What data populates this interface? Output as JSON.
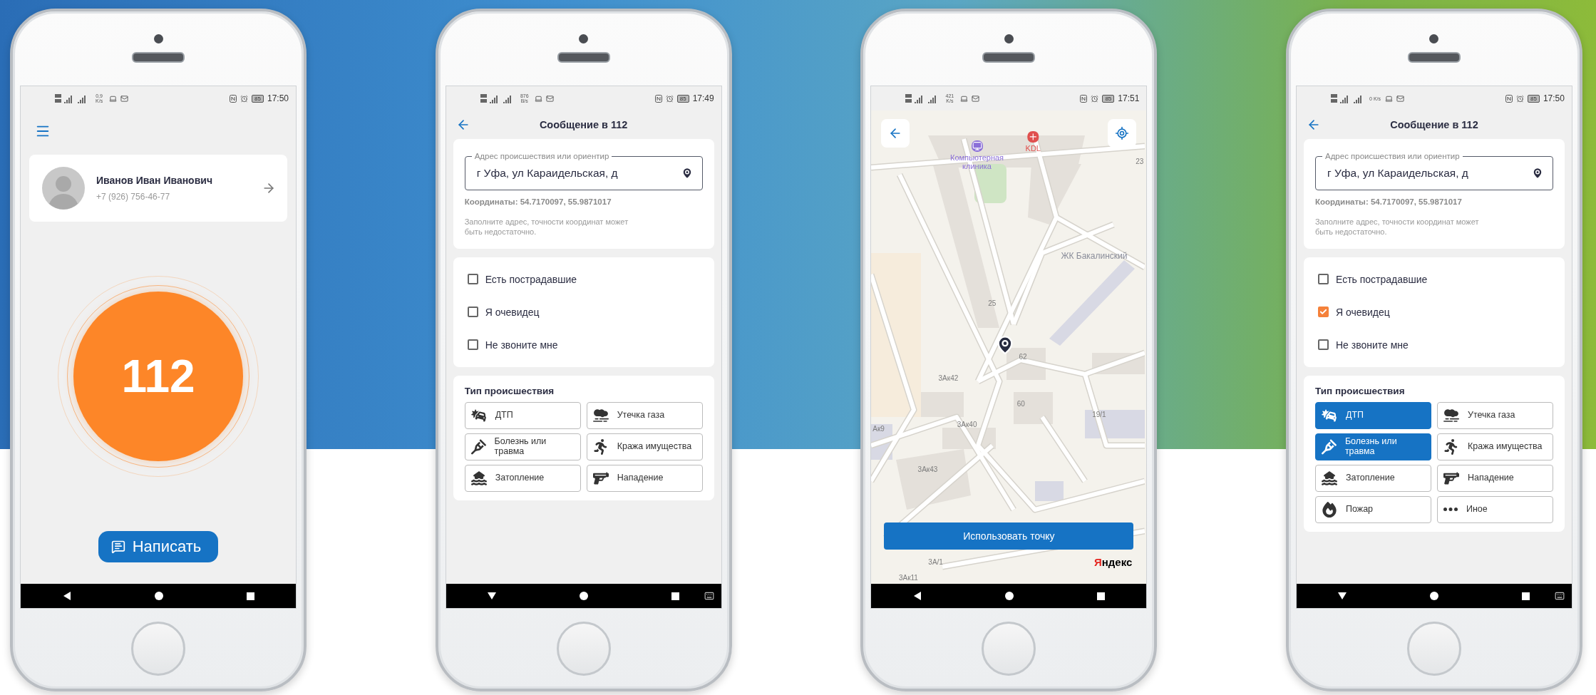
{
  "phones": [
    {
      "kind": "home",
      "status": {
        "speed": "0,9 K/s",
        "battery": "85",
        "time": "17:50"
      },
      "keyboard_shown": false,
      "profile": {
        "name": "Иванов Иван Иванович",
        "phone": "+7 (926) 756-46-77"
      },
      "sos_button": "112",
      "write_button": "Написать"
    },
    {
      "kind": "form",
      "status": {
        "speed": "876 B/s",
        "battery": "85",
        "time": "17:49"
      },
      "keyboard_shown": true,
      "title": "Сообщение в 112",
      "address": {
        "label": "Адрес происшествия или ориентир",
        "value": "г Уфа, ул Караидельская, д"
      },
      "coordinates": "Координаты: 54.7170097, 55.9871017",
      "hint": "Заполните адрес, точности координат может быть недостаточно.",
      "options": [
        {
          "label": "Есть пострадавшие",
          "checked": false
        },
        {
          "label": "Я очевидец",
          "checked": false
        },
        {
          "label": "Не звоните мне",
          "checked": false
        }
      ],
      "incident_title": "Тип происшествия",
      "incidents": [
        {
          "label": "ДТП",
          "selected": false
        },
        {
          "label": "Утечка газа",
          "selected": false
        },
        {
          "label": "Болезнь или травма",
          "selected": false
        },
        {
          "label": "Кража имущества",
          "selected": false
        },
        {
          "label": "Затопление",
          "selected": false
        },
        {
          "label": "Нападение",
          "selected": false
        }
      ]
    },
    {
      "kind": "map",
      "status": {
        "speed": "421 K/s",
        "battery": "85",
        "time": "17:51"
      },
      "keyboard_shown": false,
      "labels": [
        {
          "text": "Компьютерная клиника",
          "kind": "shop"
        },
        {
          "text": "KDL",
          "kind": "clinic"
        },
        {
          "text": "ЖК Бакалинский",
          "kind": "district"
        },
        {
          "text": "25",
          "kind": "house"
        },
        {
          "text": "62",
          "kind": "house"
        },
        {
          "text": "60",
          "kind": "house"
        },
        {
          "text": "3Ак42",
          "kind": "house"
        },
        {
          "text": "3Ак40",
          "kind": "house"
        },
        {
          "text": "3Ак43",
          "kind": "house"
        },
        {
          "text": "19/1",
          "kind": "house"
        },
        {
          "text": "Ак9",
          "kind": "house"
        },
        {
          "text": "3А/1",
          "kind": "house"
        },
        {
          "text": "3Ак11",
          "kind": "house"
        },
        {
          "text": "23",
          "kind": "house"
        }
      ],
      "use_button": "Использовать точку",
      "logo": "Яндекс"
    },
    {
      "kind": "form",
      "status": {
        "speed": "0 K/s",
        "battery": "85",
        "time": "17:50"
      },
      "keyboard_shown": true,
      "title": "Сообщение в 112",
      "address": {
        "label": "Адрес происшествия или ориентир",
        "value": "г Уфа, ул Караидельская, д"
      },
      "coordinates": "Координаты: 54.7170097, 55.9871017",
      "hint": "Заполните адрес, точности координат может быть недостаточно.",
      "options": [
        {
          "label": "Есть пострадавшие",
          "checked": false
        },
        {
          "label": "Я очевидец",
          "checked": true
        },
        {
          "label": "Не звоните мне",
          "checked": false
        }
      ],
      "incident_title": "Тип происшествия",
      "incidents": [
        {
          "label": "ДТП",
          "selected": true
        },
        {
          "label": "Утечка газа",
          "selected": false
        },
        {
          "label": "Болезнь или травма",
          "selected": true
        },
        {
          "label": "Кража имущества",
          "selected": false
        },
        {
          "label": "Затопление",
          "selected": false
        },
        {
          "label": "Нападение",
          "selected": false
        },
        {
          "label": "Пожар",
          "selected": false
        },
        {
          "label": "Иное",
          "selected": false
        }
      ]
    }
  ]
}
